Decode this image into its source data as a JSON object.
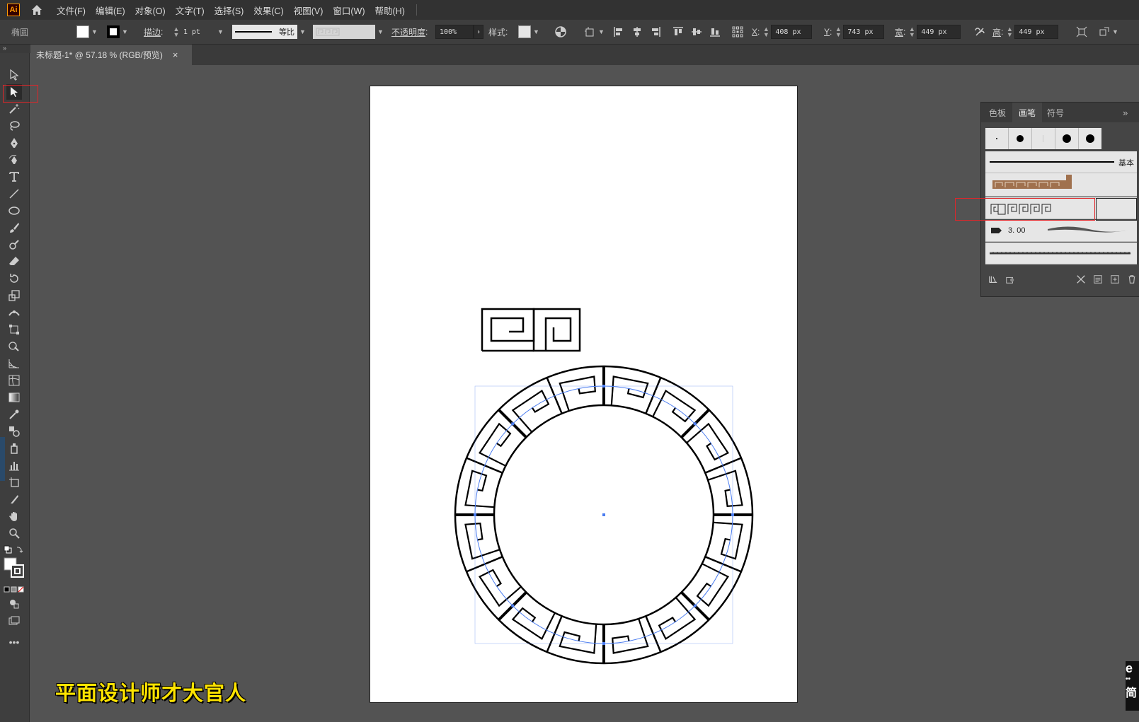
{
  "app": {
    "logo_text": "Ai"
  },
  "menu": [
    "文件(F)",
    "编辑(E)",
    "对象(O)",
    "文字(T)",
    "选择(S)",
    "效果(C)",
    "视图(V)",
    "窗口(W)",
    "帮助(H)"
  ],
  "control": {
    "object_type": "椭圆",
    "stroke_label": "描边",
    "stroke_weight": "1 pt",
    "profile_label": "等比",
    "opacity_label": "不透明度",
    "opacity_value": "100%",
    "style_label": "样式",
    "x_label": "X",
    "x_value": "408 px",
    "y_label": "Y",
    "y_value": "743 px",
    "w_label": "宽",
    "w_value": "449 px",
    "h_label": "高",
    "h_value": "449 px",
    "colon": ":"
  },
  "document": {
    "tab_title": "未标题-1* @ 57.18 % (RGB/预览)",
    "close_glyph": "×"
  },
  "panel": {
    "tabs": [
      "色板",
      "画笔",
      "符号"
    ],
    "active_tab": "画笔",
    "menu_glyph": "»",
    "basic_brush_label": "基本",
    "calligraphic_size": "3. 00"
  },
  "watermark": "平面设计师才大官人",
  "corner_logo_text": "e",
  "corner_logo_sub": "简",
  "colors": {
    "selection": "#4a7cf0",
    "highlight": "#e0262a",
    "watermark": "#ffe400"
  }
}
